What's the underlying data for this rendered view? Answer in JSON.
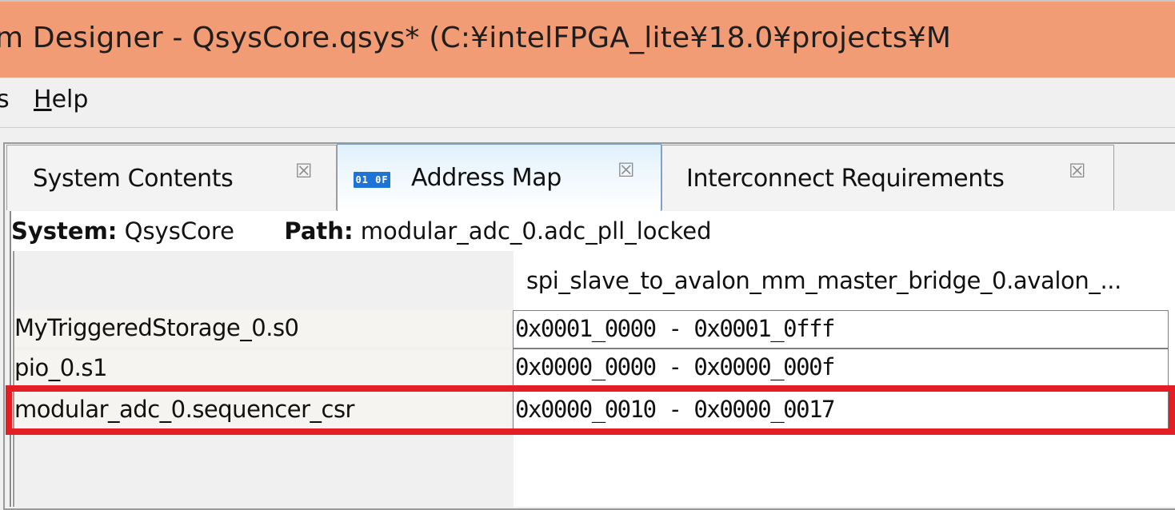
{
  "window": {
    "title": "m Designer - QsysCore.qsys* (C:¥intelFPGA_lite¥18.0¥projects¥M"
  },
  "menubar": {
    "partial_item": "s",
    "help_label_underlined": "H",
    "help_label_rest": "elp"
  },
  "tabs": [
    {
      "label": "System Contents",
      "close": "☒",
      "active": false
    },
    {
      "label": "Address Map",
      "close": "☒",
      "active": true,
      "icon_text": "01 0F"
    },
    {
      "label": "Interconnect Requirements",
      "close": "☒",
      "active": false
    }
  ],
  "info": {
    "system_key": "System:",
    "system_value": "QsysCore",
    "path_key": "Path:",
    "path_value": "modular_adc_0.adc_pll_locked"
  },
  "address_table": {
    "column_header": "spi_slave_to_avalon_mm_master_bridge_0.avalon_...",
    "rows": [
      {
        "name": "MyTriggeredStorage_0.s0",
        "range": "0x0001_0000 - 0x0001_0fff"
      },
      {
        "name": "pio_0.s1",
        "range": "0x0000_0000 - 0x0000_000f"
      },
      {
        "name": "modular_adc_0.sequencer_csr",
        "range": "0x0000_0010 - 0x0000_0017",
        "highlighted": true
      }
    ]
  },
  "colors": {
    "titlebar": "#f19c75",
    "highlight": "#e41e25",
    "tab_icon": "#1e74d6"
  }
}
